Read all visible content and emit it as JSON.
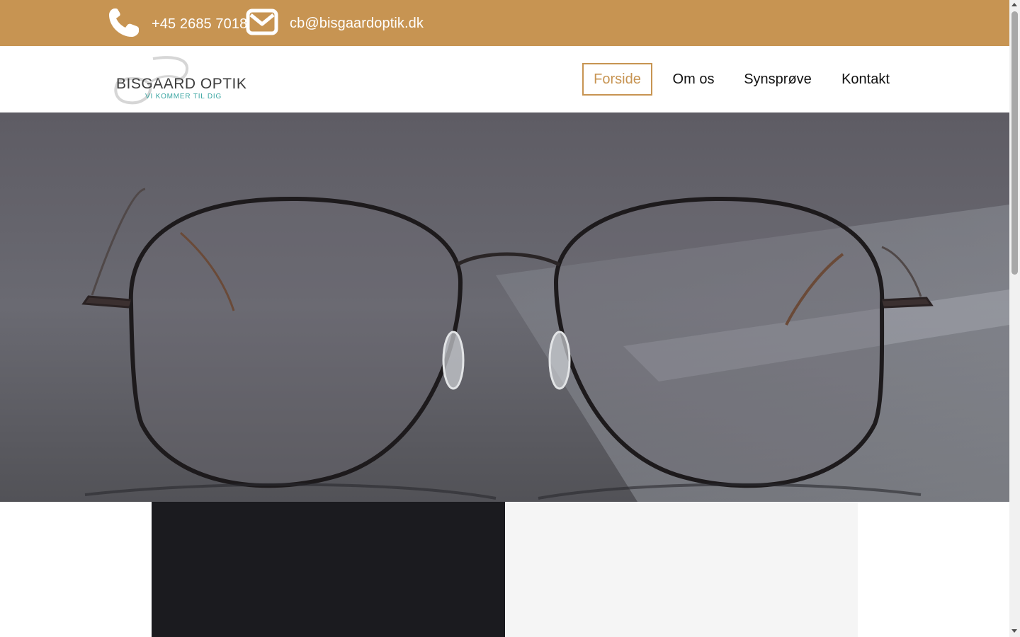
{
  "topbar": {
    "phone": "+45 2685 7018",
    "email": "cb@bisgaardoptik.dk",
    "phone_icon": "phone-icon",
    "email_icon": "envelope-icon",
    "background": "#c79452"
  },
  "header": {
    "logo": {
      "title": "BISGAARD OPTIK",
      "tagline": "VI KOMMER TIL DIG"
    },
    "nav": [
      {
        "label": "Forside",
        "active": true
      },
      {
        "label": "Om os",
        "active": false
      },
      {
        "label": "Synsprøve",
        "active": false
      },
      {
        "label": "Kontakt",
        "active": false
      }
    ],
    "accent": "#c79452"
  },
  "hero": {
    "image": "eyeglasses-on-table"
  },
  "panels": {
    "dark_color": "#1b1b1f",
    "light_color": "#f5f5f5"
  }
}
